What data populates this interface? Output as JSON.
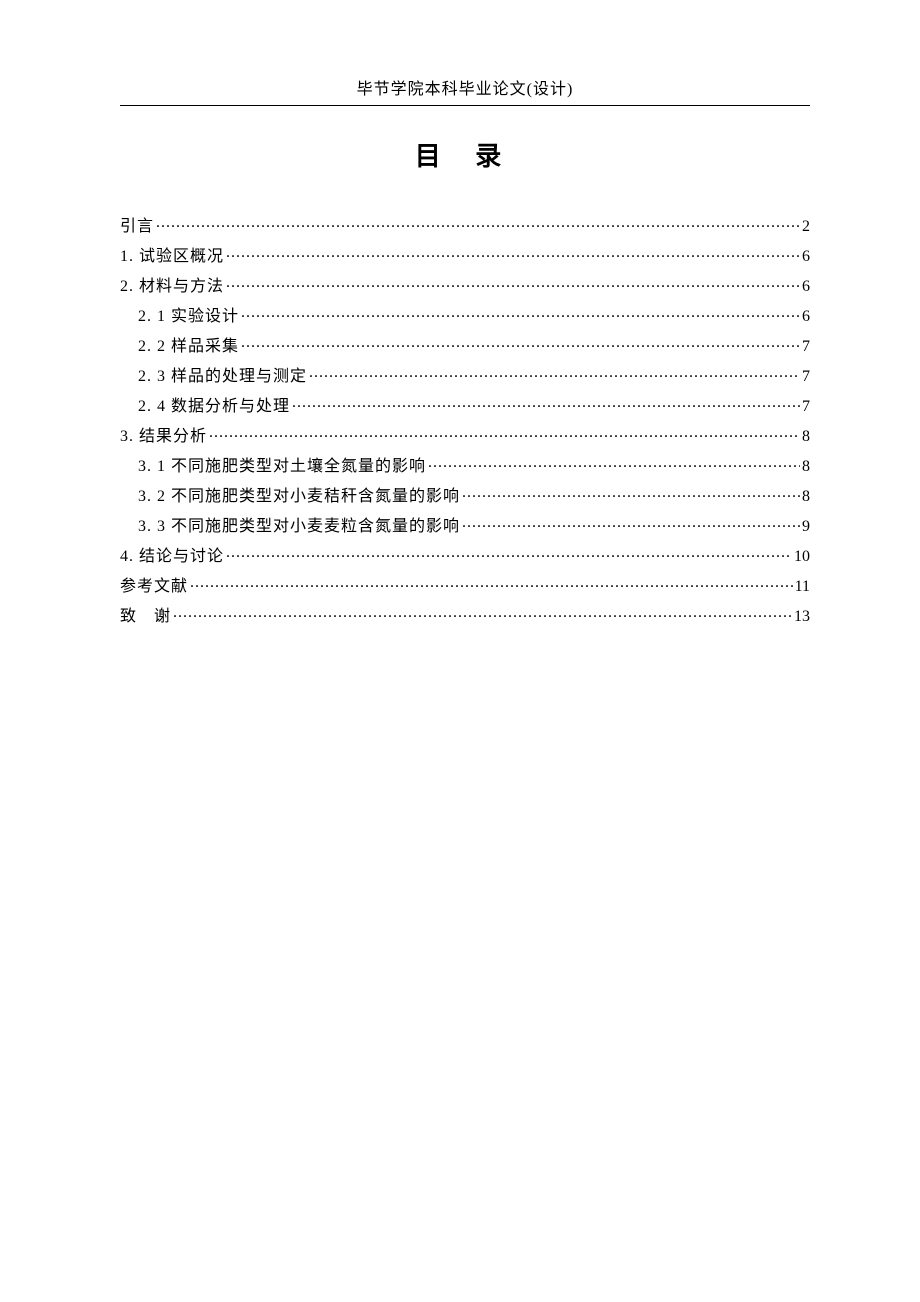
{
  "header": "毕节学院本科毕业论文(设计)",
  "toc_title": "目 录",
  "entries": [
    {
      "label": "引言",
      "page": "2",
      "level": 1
    },
    {
      "label": "1. 试验区概况",
      "page": "6",
      "level": 1
    },
    {
      "label": "2. 材料与方法",
      "page": "6",
      "level": 1
    },
    {
      "label": "2. 1 实验设计",
      "page": "6",
      "level": 2
    },
    {
      "label": "2. 2 样品采集",
      "page": "7",
      "level": 2
    },
    {
      "label": "2. 3 样品的处理与测定",
      "page": "7",
      "level": 2
    },
    {
      "label": "2. 4 数据分析与处理",
      "page": "7",
      "level": 2
    },
    {
      "label": "3. 结果分析",
      "page": "8",
      "level": 1
    },
    {
      "label": "3. 1 不同施肥类型对土壤全氮量的影响",
      "page": "8",
      "level": 2
    },
    {
      "label": "3. 2 不同施肥类型对小麦秸秆含氮量的影响",
      "page": "8",
      "level": 2
    },
    {
      "label": "3. 3 不同施肥类型对小麦麦粒含氮量的影响",
      "page": "9",
      "level": 2
    },
    {
      "label": "4. 结论与讨论",
      "page": "10",
      "level": 1
    },
    {
      "label": "参考文献",
      "page": "11",
      "level": 1
    },
    {
      "label": "致　谢",
      "page": "13",
      "level": 1
    }
  ]
}
